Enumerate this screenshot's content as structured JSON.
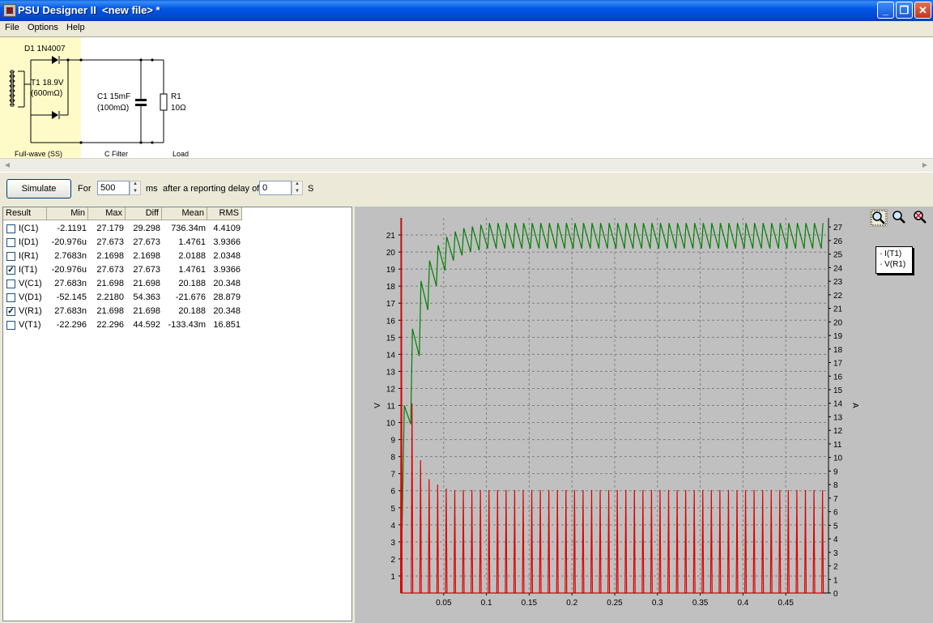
{
  "window": {
    "title": "PSU Designer II  <new file> *"
  },
  "menu": [
    "File",
    "Options",
    "Help"
  ],
  "schematic": {
    "diode_label": "D1 1N4007",
    "transformer_label": "T1 18.9V",
    "transformer_res": "(600mΩ)",
    "cap_label": "C1 15mF",
    "cap_res": "(100mΩ)",
    "res_label": "R1",
    "res_value": "10Ω",
    "section_rect": "Full-wave (SS)",
    "section_filter": "C Filter",
    "section_load": "Load"
  },
  "sim": {
    "button": "Simulate",
    "for_label": "For",
    "duration": "500",
    "ms_label": "ms",
    "delay_label": "after a reporting delay of",
    "delay": "0",
    "s_label": "S"
  },
  "results": {
    "columns": [
      "Result",
      "Min",
      "Max",
      "Diff",
      "Mean",
      "RMS"
    ],
    "rows": [
      {
        "checked": false,
        "name": "I(C1)",
        "min": "-2.1191",
        "max": "27.179",
        "diff": "29.298",
        "mean": "736.34m",
        "rms": "4.4109"
      },
      {
        "checked": false,
        "name": "I(D1)",
        "min": "-20.976u",
        "max": "27.673",
        "diff": "27.673",
        "mean": "1.4761",
        "rms": "3.9366"
      },
      {
        "checked": false,
        "name": "I(R1)",
        "min": "2.7683n",
        "max": "2.1698",
        "diff": "2.1698",
        "mean": "2.0188",
        "rms": "2.0348"
      },
      {
        "checked": true,
        "name": "I(T1)",
        "min": "-20.976u",
        "max": "27.673",
        "diff": "27.673",
        "mean": "1.4761",
        "rms": "3.9366"
      },
      {
        "checked": false,
        "name": "V(C1)",
        "min": "27.683n",
        "max": "21.698",
        "diff": "21.698",
        "mean": "20.188",
        "rms": "20.348"
      },
      {
        "checked": false,
        "name": "V(D1)",
        "min": "-52.145",
        "max": "2.2180",
        "diff": "54.363",
        "mean": "-21.676",
        "rms": "28.879"
      },
      {
        "checked": true,
        "name": "V(R1)",
        "min": "27.683n",
        "max": "21.698",
        "diff": "21.698",
        "mean": "20.188",
        "rms": "20.348"
      },
      {
        "checked": false,
        "name": "V(T1)",
        "min": "-22.296",
        "max": "22.296",
        "diff": "44.592",
        "mean": "-133.43m",
        "rms": "16.851"
      }
    ]
  },
  "toolbar_icons": [
    "zoom-area-icon",
    "zoom-icon",
    "zoom-reset-icon"
  ],
  "chart_data": {
    "type": "line",
    "ylabel": "V",
    "y2label": "A",
    "xlim": [
      0,
      0.5
    ],
    "ylim": [
      0,
      22
    ],
    "y2lim": [
      0,
      27.67
    ],
    "x_ticks": [
      "0.05",
      "0.1",
      "0.15",
      "0.2",
      "0.25",
      "0.3",
      "0.35",
      "0.4",
      "0.45"
    ],
    "y_ticks": [
      "1",
      "2",
      "3",
      "4",
      "5",
      "6",
      "7",
      "8",
      "9",
      "10",
      "11",
      "12",
      "13",
      "14",
      "15",
      "16",
      "17",
      "18",
      "19",
      "20",
      "21"
    ],
    "y2_ticks": [
      "0",
      "1",
      "2",
      "3",
      "4",
      "5",
      "6",
      "7",
      "8",
      "9",
      "10",
      "11",
      "12",
      "13",
      "14",
      "15",
      "16",
      "17",
      "18",
      "19",
      "20",
      "21",
      "22",
      "23",
      "24",
      "25",
      "26",
      "27"
    ],
    "grid": true,
    "legend_position": "right",
    "series": [
      {
        "name": "I(T1)",
        "axis": "right",
        "color": "#e00000",
        "note_period_s": 0.01,
        "peaks": [
          27.67,
          14.0,
          9.8,
          8.4,
          8.0,
          7.7,
          7.6,
          7.6,
          7.6,
          7.6,
          7.6,
          7.6,
          7.6,
          7.6,
          7.6,
          7.6,
          7.6,
          7.6,
          7.6,
          7.6,
          7.6,
          7.6,
          7.6,
          7.6,
          7.6,
          7.6,
          7.6,
          7.6,
          7.6,
          7.6,
          7.6,
          7.6,
          7.6,
          7.6,
          7.6,
          7.6,
          7.6,
          7.6,
          7.6,
          7.6,
          7.6,
          7.6,
          7.6,
          7.6,
          7.6,
          7.6,
          7.6,
          7.6,
          7.6,
          7.6
        ]
      },
      {
        "name": "V(R1)",
        "axis": "left",
        "color": "#008000",
        "peaks": [
          11.0,
          15.5,
          18.3,
          19.5,
          20.4,
          20.9,
          21.2,
          21.4,
          21.5,
          21.6,
          21.7,
          21.7,
          21.7,
          21.7,
          21.7,
          21.7,
          21.7,
          21.7,
          21.7,
          21.7,
          21.7,
          21.7,
          21.7,
          21.7,
          21.7,
          21.7,
          21.7,
          21.7,
          21.7,
          21.7,
          21.7,
          21.7,
          21.7,
          21.7,
          21.7,
          21.7,
          21.7,
          21.7,
          21.7,
          21.7,
          21.7,
          21.7,
          21.7,
          21.7,
          21.7,
          21.7,
          21.7,
          21.7,
          21.7,
          21.7
        ],
        "troughs": [
          9.9,
          13.9,
          16.6,
          18.0,
          18.9,
          19.5,
          19.8,
          20.0,
          20.1,
          20.2,
          20.2,
          20.2,
          20.2,
          20.2,
          20.2,
          20.2,
          20.2,
          20.2,
          20.2,
          20.2,
          20.2,
          20.2,
          20.2,
          20.2,
          20.2,
          20.2,
          20.2,
          20.2,
          20.2,
          20.2,
          20.2,
          20.2,
          20.2,
          20.2,
          20.2,
          20.2,
          20.2,
          20.2,
          20.2,
          20.2,
          20.2,
          20.2,
          20.2,
          20.2,
          20.2,
          20.2,
          20.2,
          20.2,
          20.2,
          20.2
        ]
      }
    ]
  }
}
